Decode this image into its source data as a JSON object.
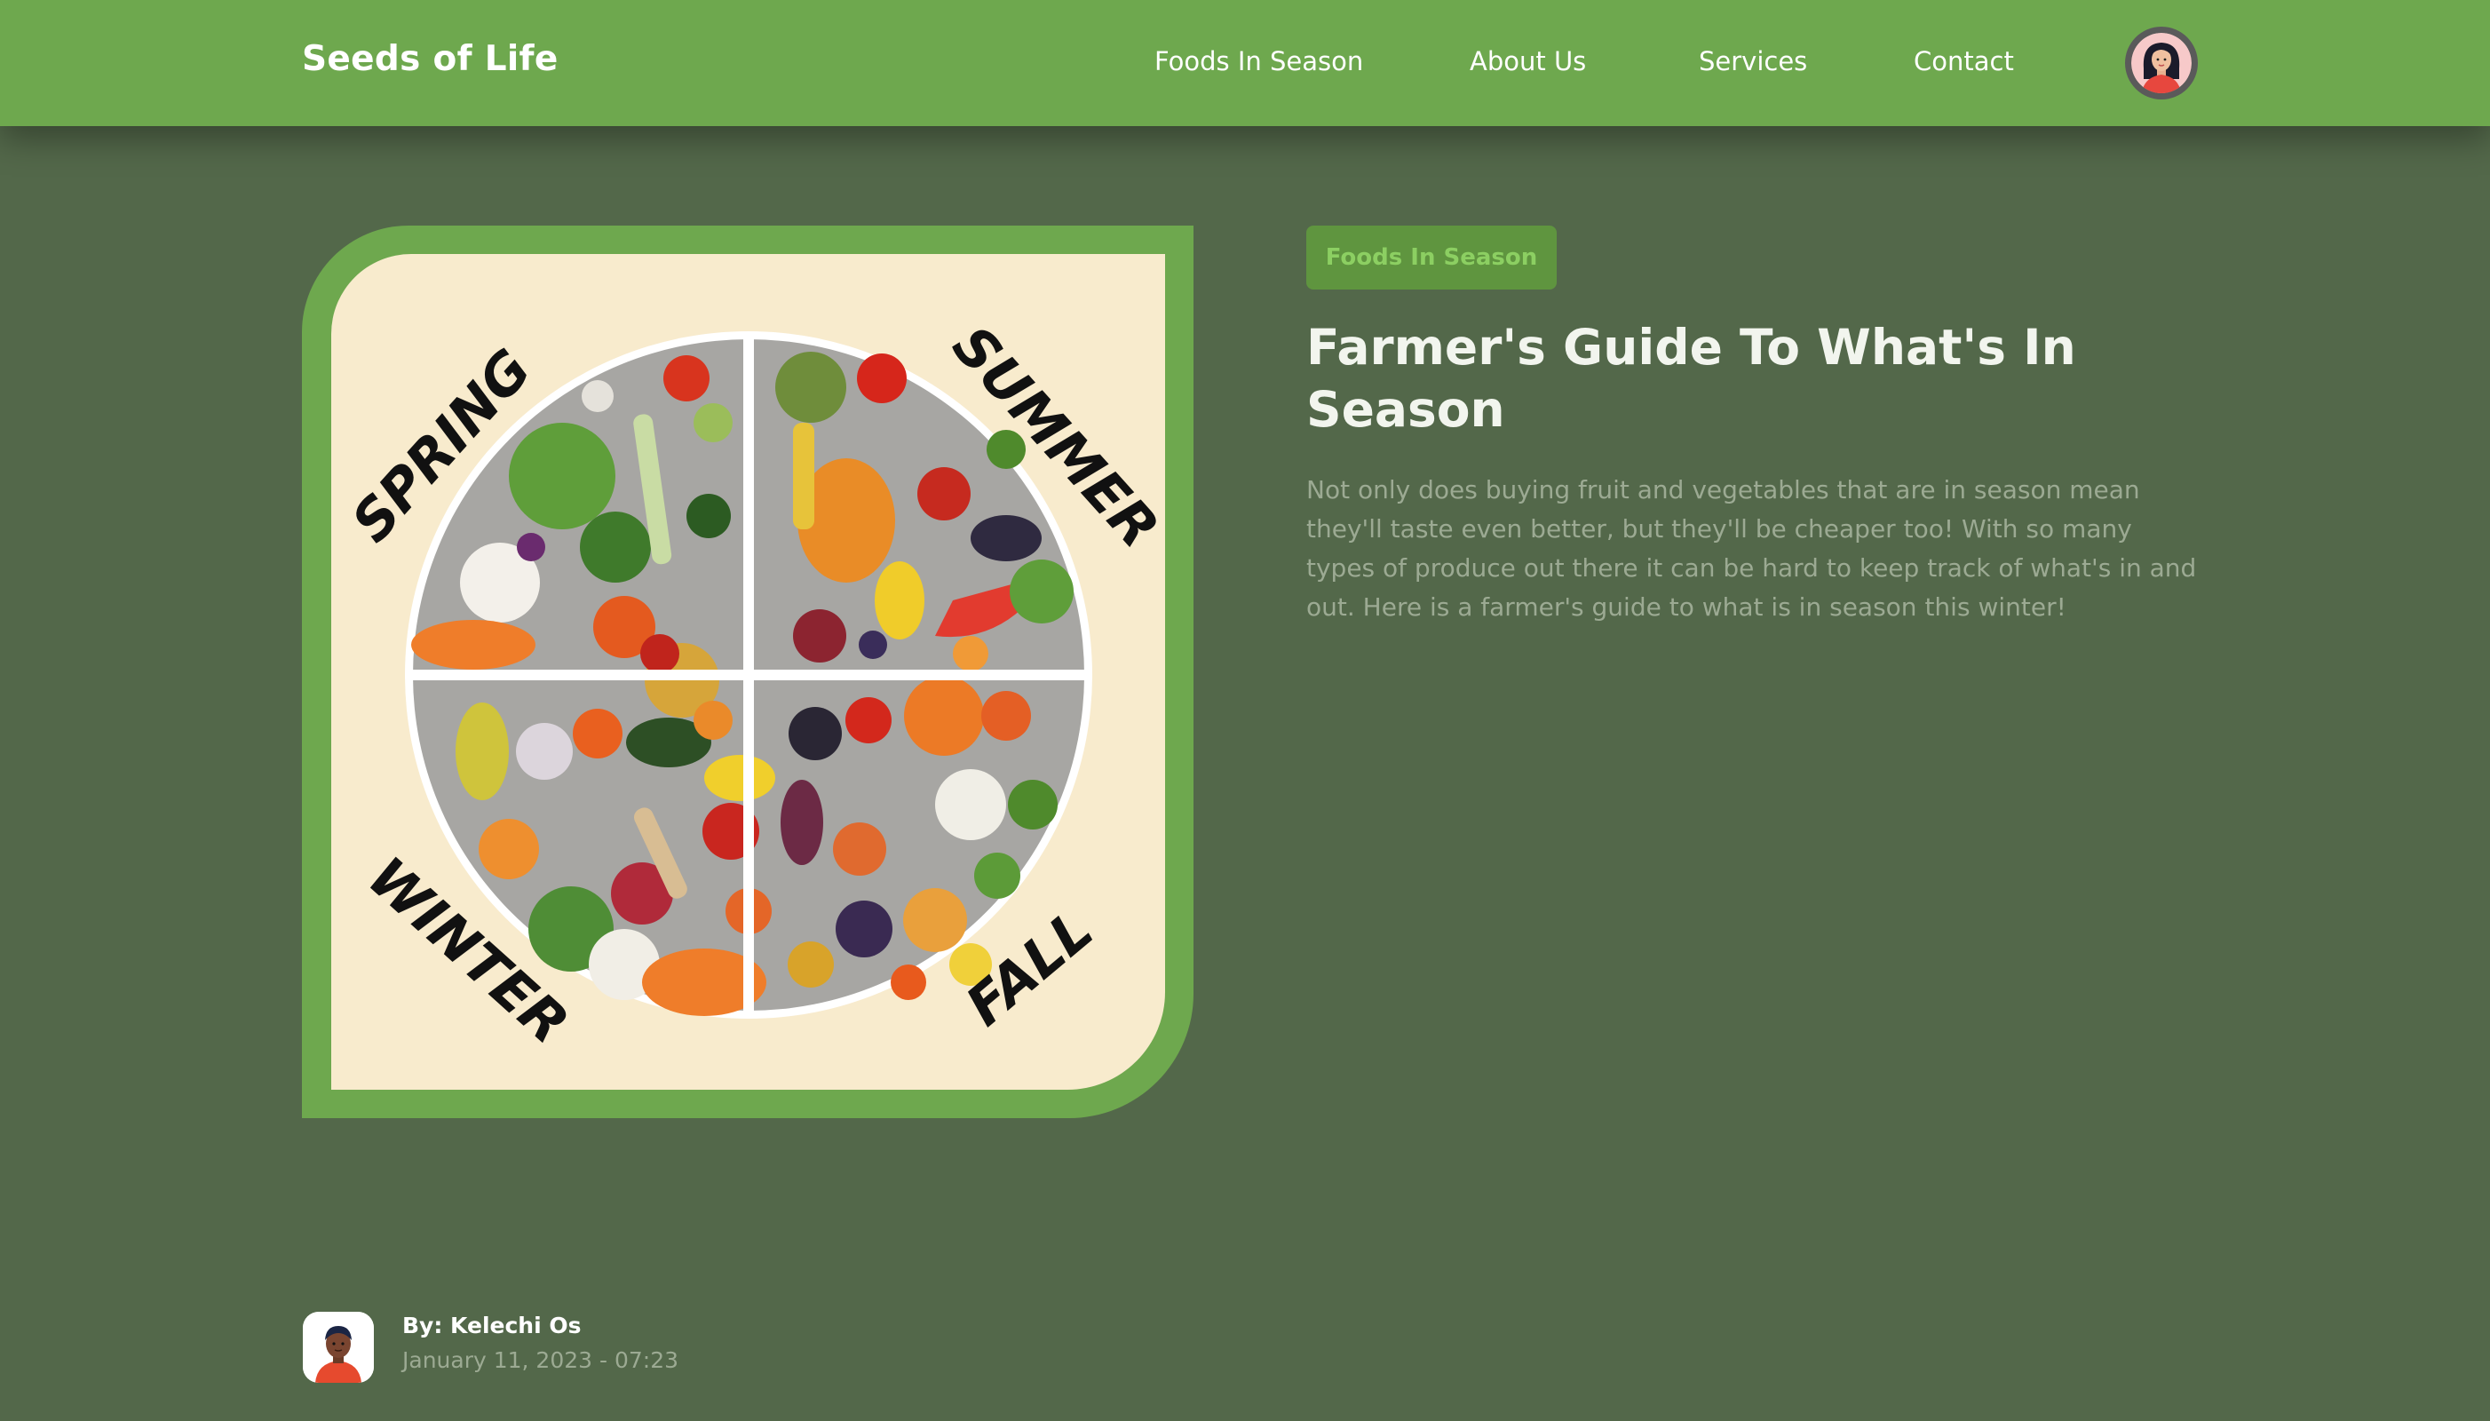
{
  "nav": {
    "brand": "Seeds of Life",
    "links": [
      "Foods In Season",
      "About Us",
      "Services",
      "Contact"
    ],
    "avatar_icon": "user-avatar-icon"
  },
  "hero": {
    "image_icon": "seasonal-produce-wheel-illustration",
    "seasons": [
      "SPRING",
      "SUMMER",
      "WINTER",
      "FALL"
    ]
  },
  "article": {
    "tag": "Foods In Season",
    "title": "Farmer's Guide To What's In Season",
    "description": "Not only does buying fruit and vegetables that are in season mean they'll taste even better, but they'll be cheaper too! With so many types of produce out there it can be hard to keep track of what's in and out. Here is a farmer's guide to what is in season this winter!"
  },
  "author": {
    "name": "By: Kelechi Os",
    "date": "January 11, 2023 - 07:23",
    "avatar_icon": "author-avatar-icon"
  },
  "colors": {
    "background": "#53684a",
    "navbar": "#6ea84e",
    "tag_bg": "#5f953f",
    "tag_text": "#8ccf62",
    "image_bg": "#f8ebcd"
  }
}
